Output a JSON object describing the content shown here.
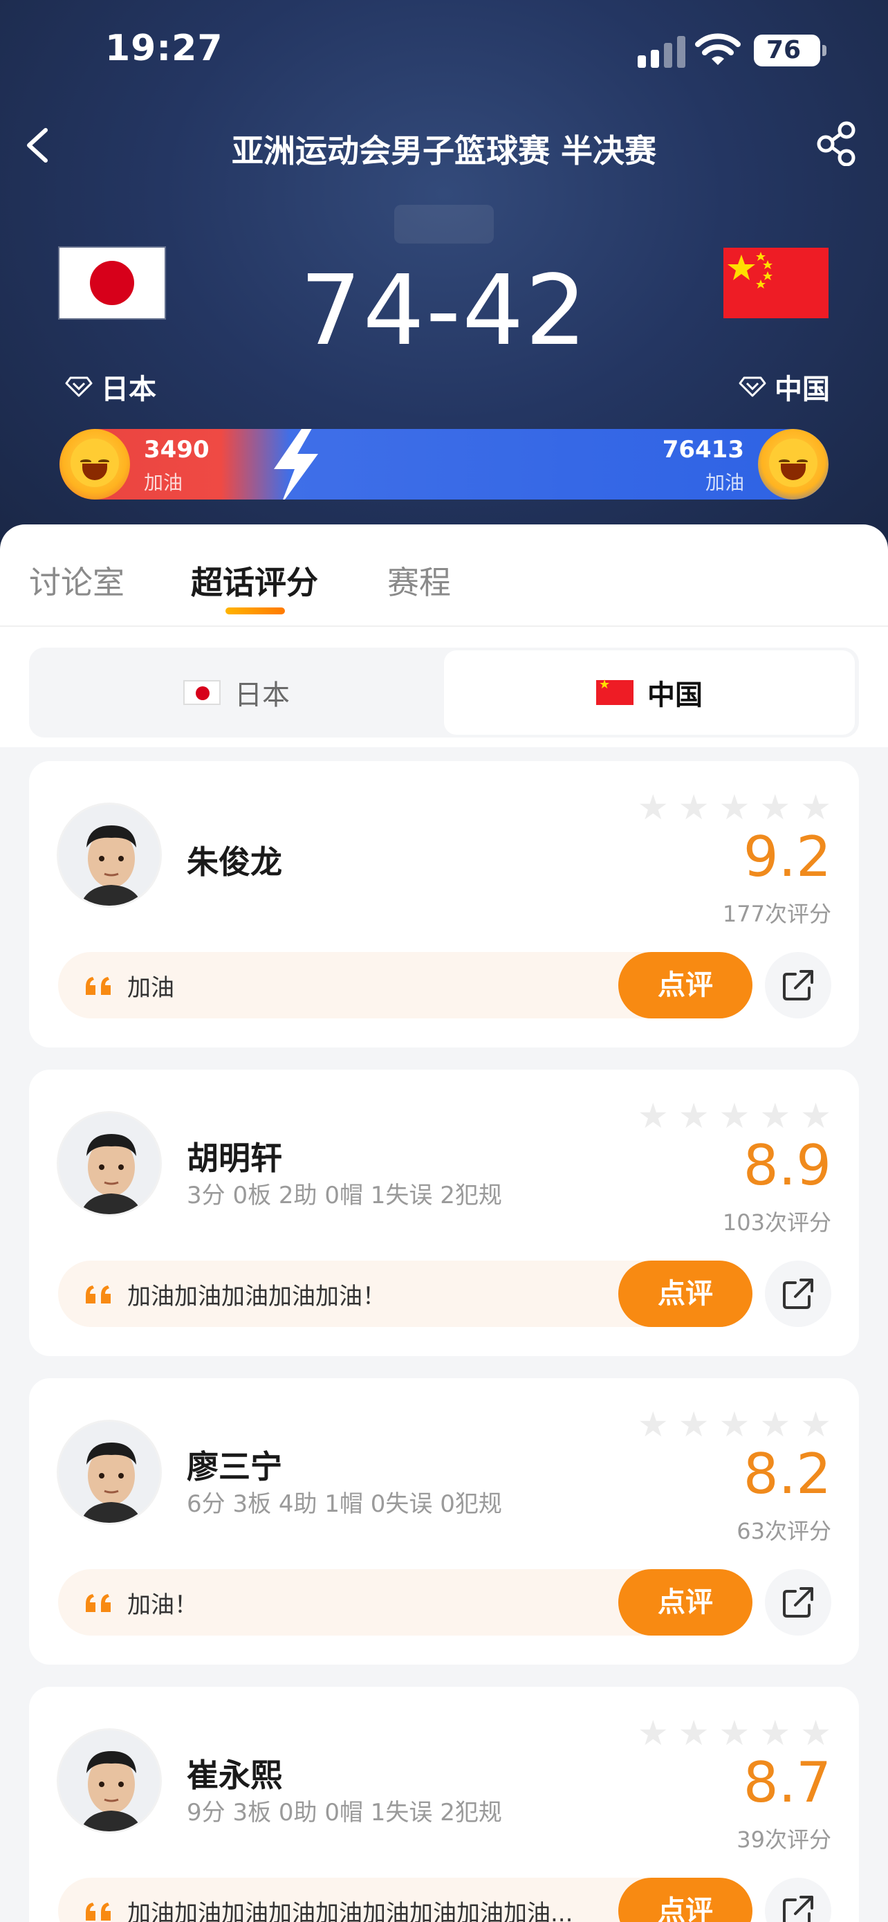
{
  "status": {
    "time": "19:27",
    "battery": "76"
  },
  "nav": {
    "title": "亚洲运动会男子篮球赛 半决赛"
  },
  "match": {
    "score": "74-42",
    "home_team": "日本",
    "away_team": "中国"
  },
  "cheer": {
    "home_count": "3490",
    "home_label": "加油",
    "away_count": "76413",
    "away_label": "加油"
  },
  "tabs": [
    {
      "label": "讨论室"
    },
    {
      "label": "超话评分"
    },
    {
      "label": "赛程"
    }
  ],
  "team_switch": {
    "left": "日本",
    "right": "中国"
  },
  "review_button_label": "点评",
  "players": [
    {
      "name": "朱俊龙",
      "stats": "",
      "rating": "9.2",
      "count": "177次评分",
      "comment": "加油"
    },
    {
      "name": "胡明轩",
      "stats": "3分 0板 2助 0帽 1失误 2犯规",
      "rating": "8.9",
      "count": "103次评分",
      "comment": "加油加油加油加油加油！"
    },
    {
      "name": "廖三宁",
      "stats": "6分 3板 4助 1帽 0失误 0犯规",
      "rating": "8.2",
      "count": "63次评分",
      "comment": "加油！"
    },
    {
      "name": "崔永熙",
      "stats": "9分 3板 0助 0帽 1失误 2犯规",
      "rating": "8.7",
      "count": "39次评分",
      "comment": "加油加油加油加油加油加油加油加油加油..."
    }
  ],
  "colors": {
    "accent": "#f88a12",
    "rating": "#f08a1c",
    "header": "#243662"
  }
}
